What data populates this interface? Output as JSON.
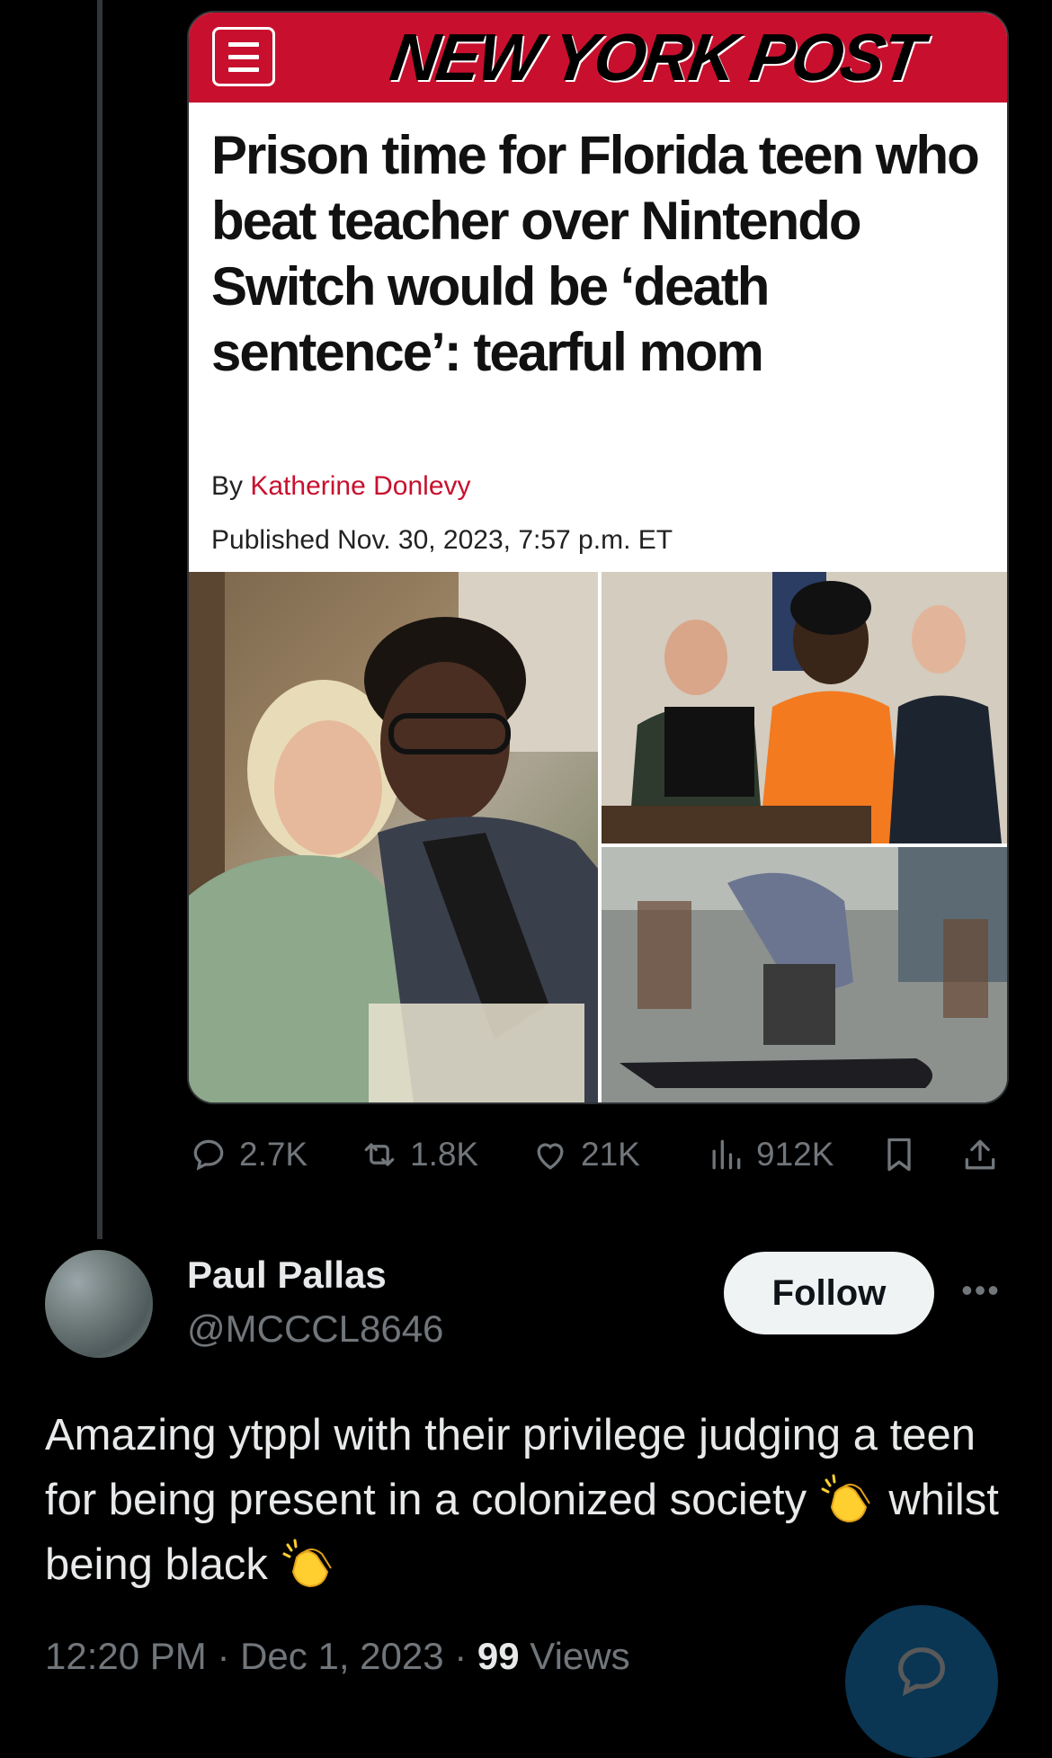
{
  "article": {
    "publication": "NEW YORK POST",
    "headline": "Prison time for Florida teen who beat teacher over Nintendo Switch would be ‘death sentence’: tearful mom",
    "byline_prefix": "By ",
    "author": "Katherine Donlevy",
    "published": "Published Nov. 30, 2023, 7:57 p.m. ET"
  },
  "stats": {
    "replies": "2.7K",
    "reposts": "1.8K",
    "likes": "21K",
    "views": "912K"
  },
  "reply": {
    "display_name": "Paul Pallas",
    "handle": "@MCCCL8646",
    "follow_label": "Follow",
    "text_part1": "Amazing ytppl with their privilege judging a teen for being present in a colonized society ",
    "text_part2": " whilst being black ",
    "time": "12:20 PM · Dec 1, 2023 · ",
    "views_count": "99",
    "views_label": " Views"
  },
  "colors": {
    "background": "#000000",
    "np_red": "#c8102e",
    "muted": "#71767b",
    "text": "#e7e9ea",
    "accent": "#1d9bf0"
  },
  "icons": [
    "menu-icon",
    "reply-icon",
    "repost-icon",
    "like-icon",
    "views-icon",
    "bookmark-icon",
    "share-icon",
    "more-icon",
    "clapping-hands-icon",
    "compose-reply-icon"
  ]
}
